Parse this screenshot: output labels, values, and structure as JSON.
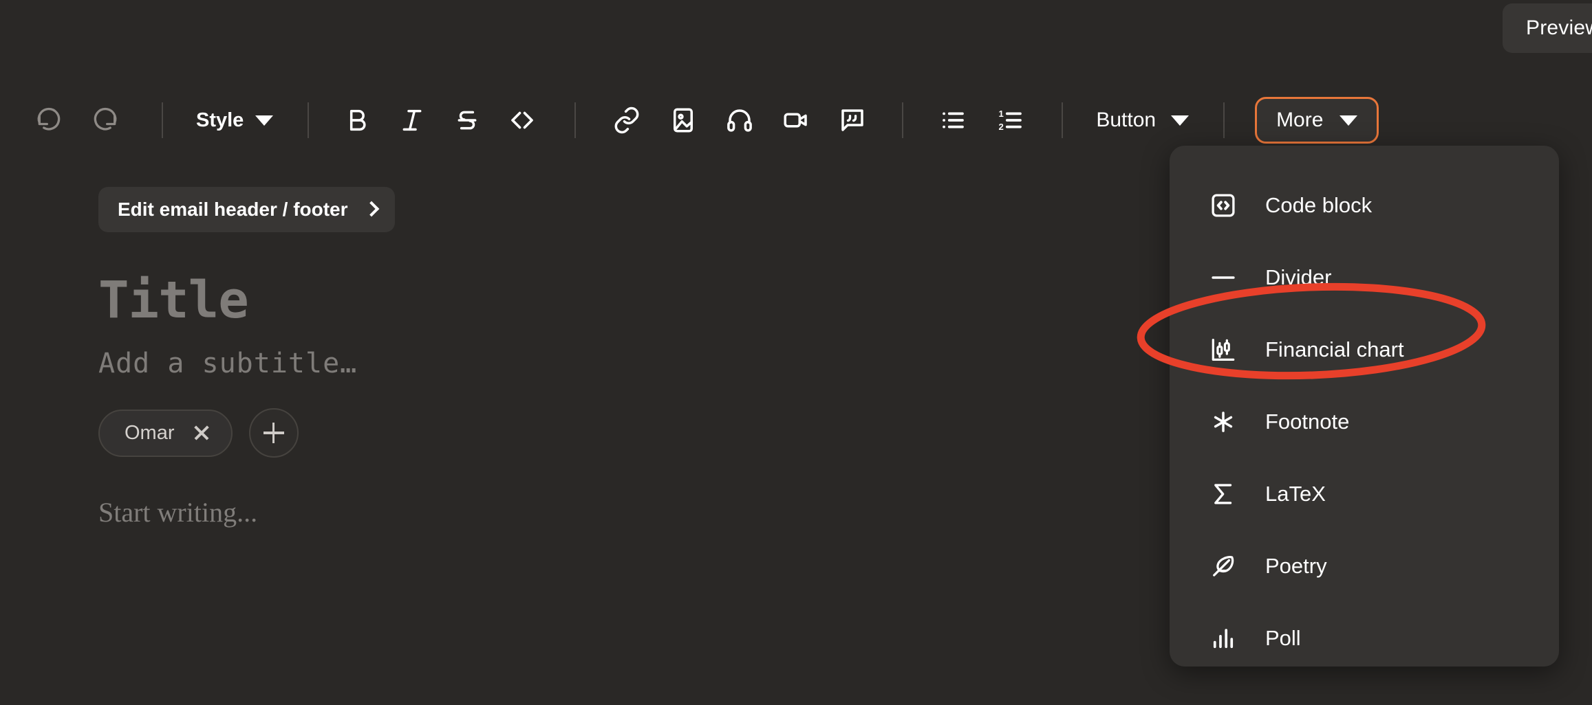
{
  "header": {
    "preview_label": "Preview"
  },
  "toolbar": {
    "undo_icon": "undo-icon",
    "redo_icon": "redo-icon",
    "style_label": "Style",
    "format": [
      {
        "name": "bold-icon",
        "label": "B"
      },
      {
        "name": "italic-icon",
        "label": "I"
      },
      {
        "name": "strikethrough-icon",
        "label": "S"
      },
      {
        "name": "code-icon",
        "label": "<>"
      }
    ],
    "embeds": [
      {
        "name": "link-icon",
        "label": "Link"
      },
      {
        "name": "image-icon",
        "label": "Image"
      },
      {
        "name": "audio-icon",
        "label": "Audio"
      },
      {
        "name": "video-icon",
        "label": "Video"
      },
      {
        "name": "quote-icon",
        "label": "Quote"
      }
    ],
    "lists": [
      {
        "name": "bullet-list-icon",
        "label": "Bulleted list"
      },
      {
        "name": "numbered-list-icon",
        "label": "Numbered list"
      }
    ],
    "button_label": "Button",
    "more_label": "More",
    "more_highlight_color": "#e8763a"
  },
  "document": {
    "email_chip_label": "Edit email header / footer",
    "title": "Title",
    "subtitle_placeholder": "Add a subtitle…",
    "authors": [
      {
        "name": "Omar"
      }
    ],
    "add_author_label": "+",
    "body_placeholder": "Start writing..."
  },
  "more_menu": {
    "items": [
      {
        "label": "Code block",
        "icon": "code-block-icon"
      },
      {
        "label": "Divider",
        "icon": "divider-icon"
      },
      {
        "label": "Financial chart",
        "icon": "financial-chart-icon"
      },
      {
        "label": "Footnote",
        "icon": "footnote-icon"
      },
      {
        "label": "LaTeX",
        "icon": "latex-icon"
      },
      {
        "label": "Poetry",
        "icon": "poetry-icon"
      },
      {
        "label": "Poll",
        "icon": "poll-icon"
      }
    ]
  },
  "annotation": {
    "shape": "ellipse",
    "target_label": "Financial chart",
    "color": "#e8402a"
  }
}
